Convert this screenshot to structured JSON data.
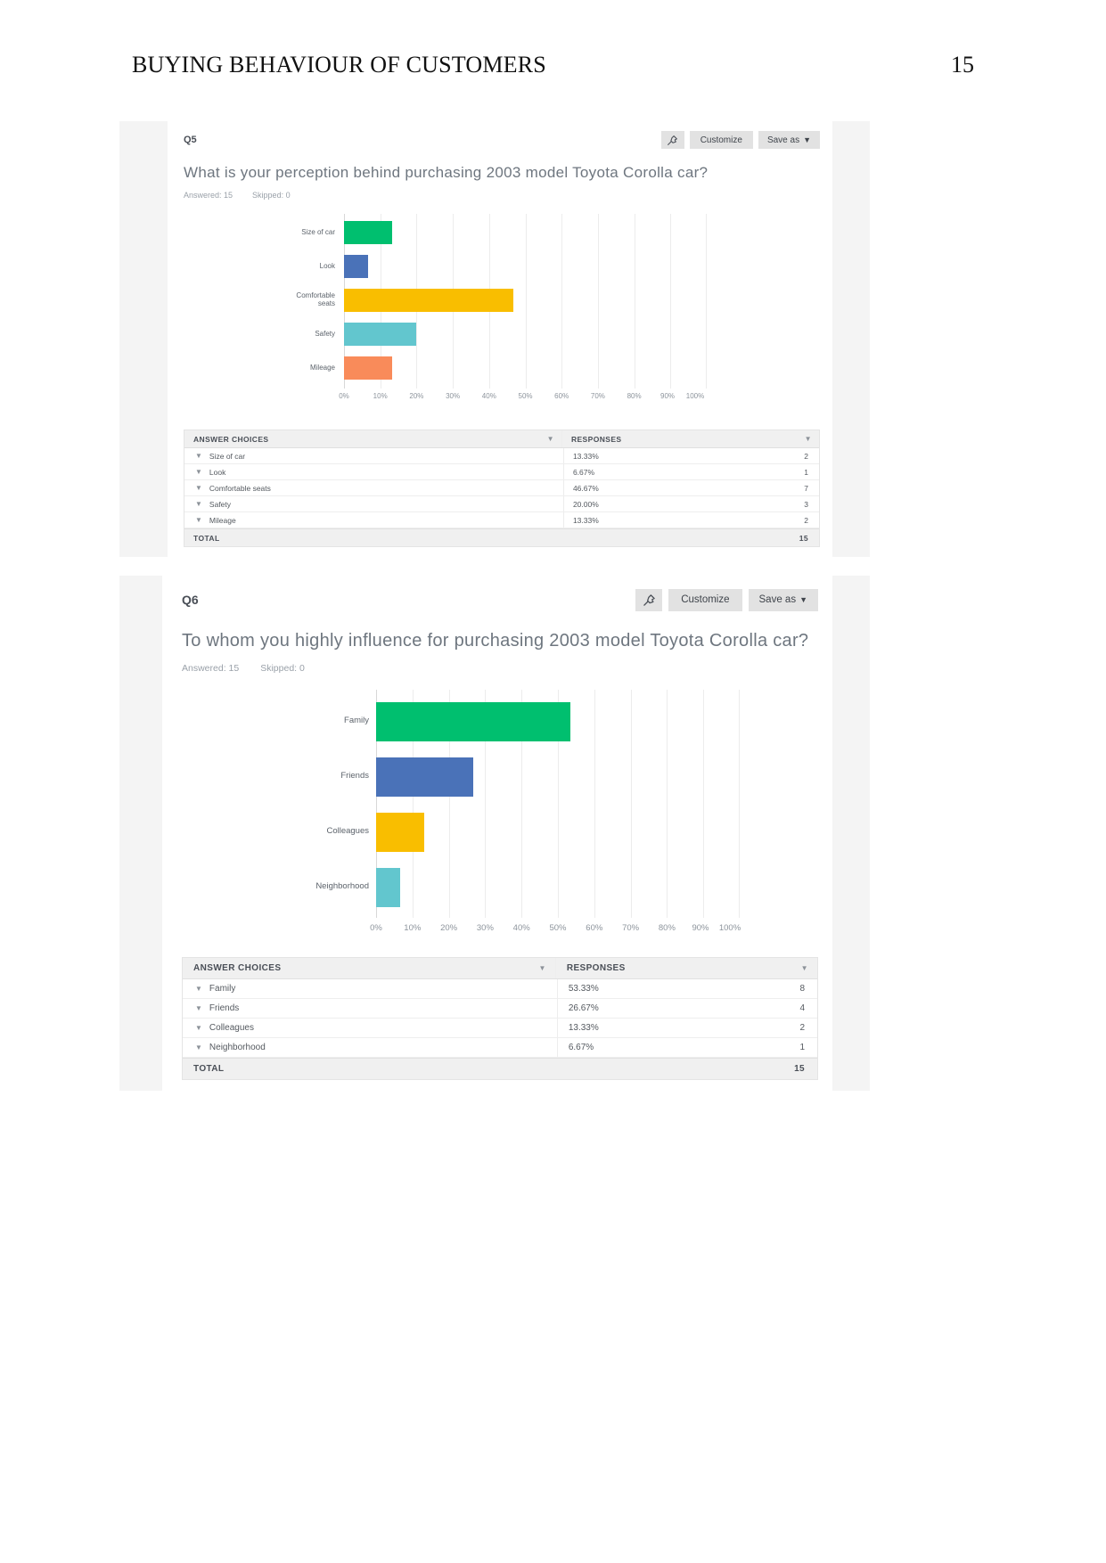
{
  "document": {
    "header_title": "BUYING BEHAVIOUR OF CUSTOMERS",
    "page_number": "15"
  },
  "colors": {
    "green": "#00bf6f",
    "blue": "#4a72b8",
    "yellow": "#f9be00",
    "teal": "#62c6ce",
    "orange": "#f98b5a",
    "button_bg": "#e2e2e2",
    "table_header_bg": "#f0f0f0"
  },
  "cards": [
    {
      "question_number": "Q5",
      "pin_icon": "pushpin-icon",
      "customize_label": "Customize",
      "save_as_label": "Save as",
      "save_as_caret": "▼",
      "title": "What is your perception behind purchasing 2003 model Toyota Corolla car?",
      "answered_label": "Answered: 15",
      "skipped_label": "Skipped: 0",
      "table": {
        "col_choices": "ANSWER CHOICES",
        "col_responses": "RESPONSES",
        "total_label": "TOTAL",
        "total_value": "15",
        "rows": [
          {
            "choice": "Size of car",
            "percent": "13.33%",
            "count": "2"
          },
          {
            "choice": "Look",
            "percent": "6.67%",
            "count": "1"
          },
          {
            "choice": "Comfortable seats",
            "percent": "46.67%",
            "count": "7"
          },
          {
            "choice": "Safety",
            "percent": "20.00%",
            "count": "3"
          },
          {
            "choice": "Mileage",
            "percent": "13.33%",
            "count": "2"
          }
        ]
      },
      "chart_data": {
        "type": "bar",
        "orientation": "horizontal",
        "title": "What is your perception behind purchasing 2003 model Toyota Corolla car?",
        "xlabel": "",
        "ylabel": "",
        "xlim": [
          0,
          100
        ],
        "grid": true,
        "legend": "none",
        "categories": [
          "Size of car",
          "Look",
          "Comfortable seats",
          "Safety",
          "Mileage"
        ],
        "values": [
          13.33,
          6.67,
          46.67,
          20.0,
          13.33
        ],
        "counts": [
          2,
          1,
          7,
          3,
          2
        ],
        "bar_colors": [
          "#00bf6f",
          "#4a72b8",
          "#f9be00",
          "#62c6ce",
          "#f98b5a"
        ],
        "xticks": [
          "0%",
          "10%",
          "20%",
          "30%",
          "40%",
          "50%",
          "60%",
          "70%",
          "80%",
          "90%",
          "100%"
        ]
      }
    },
    {
      "question_number": "Q6",
      "pin_icon": "pushpin-icon",
      "customize_label": "Customize",
      "save_as_label": "Save as",
      "save_as_caret": "▼",
      "title": "To whom you highly influence for purchasing 2003 model Toyota Corolla car?",
      "answered_label": "Answered: 15",
      "skipped_label": "Skipped: 0",
      "table": {
        "col_choices": "ANSWER CHOICES",
        "col_responses": "RESPONSES",
        "total_label": "TOTAL",
        "total_value": "15",
        "rows": [
          {
            "choice": "Family",
            "percent": "53.33%",
            "count": "8"
          },
          {
            "choice": "Friends",
            "percent": "26.67%",
            "count": "4"
          },
          {
            "choice": "Colleagues",
            "percent": "13.33%",
            "count": "2"
          },
          {
            "choice": "Neighborhood",
            "percent": "6.67%",
            "count": "1"
          }
        ]
      },
      "chart_data": {
        "type": "bar",
        "orientation": "horizontal",
        "title": "To whom you highly influence for purchasing 2003 model Toyota Corolla car?",
        "xlabel": "",
        "ylabel": "",
        "xlim": [
          0,
          100
        ],
        "grid": true,
        "legend": "none",
        "categories": [
          "Family",
          "Friends",
          "Colleagues",
          "Neighborhood"
        ],
        "values": [
          53.33,
          26.67,
          13.33,
          6.67
        ],
        "counts": [
          8,
          4,
          2,
          1
        ],
        "bar_colors": [
          "#00bf6f",
          "#4a72b8",
          "#f9be00",
          "#62c6ce"
        ],
        "xticks": [
          "0%",
          "10%",
          "20%",
          "30%",
          "40%",
          "50%",
          "60%",
          "70%",
          "80%",
          "90%",
          "100%"
        ]
      }
    }
  ]
}
